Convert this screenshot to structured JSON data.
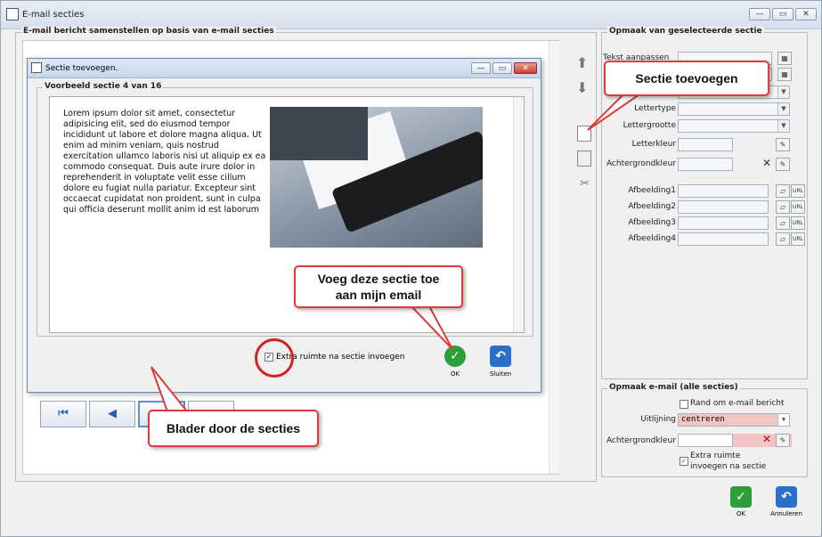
{
  "window": {
    "title": "E-mail secties"
  },
  "compose_group": {
    "title": "E-mail bericht samenstellen op basis van e-mail secties"
  },
  "format_selected": {
    "title": "Opmaak van geselecteerde sectie",
    "tekst_label": "Tekst aanpassen",
    "lettertype_label": "Lettertype",
    "lettergrootte_label": "Lettergrootte",
    "letterkleur_label": "Letterkleur",
    "achtergrondkleur_label": "Achtergrondkleur",
    "afbeelding_labels": [
      "Afbeelding1",
      "Afbeelding2",
      "Afbeelding3",
      "Afbeelding4"
    ]
  },
  "format_email": {
    "title": "Opmaak e-mail (alle secties)",
    "rand_label": "Rand om e-mail bericht",
    "uitlijning_label": "Uitlijning",
    "uitlijning_value": "centreren",
    "achtergrondkleur_label": "Achtergrondkleur",
    "extra_label_1": "Extra ruimte",
    "extra_label_2": "invoegen na sectie"
  },
  "dialog": {
    "title": "Sectie toevoegen.",
    "preview_title": "Voorbeeld sectie 4 van 16",
    "preview_text": "Lorem ipsum dolor sit amet, consectetur adipisicing elit, sed do eiusmod tempor incididunt ut labore et dolore magna aliqua. Ut enim ad minim veniam, quis nostrud exercitation ullamco laboris nisi ut aliquip ex ea commodo consequat. Duis aute irure dolor in reprehenderit in voluptate velit esse cillum dolore eu fugiat nulla pariatur. Excepteur sint occaecat cupidatat non proident, sunt in culpa qui officia deserunt mollit anim id est laborum",
    "extra_checkbox_label": "Extra ruimte na sectie invoegen",
    "ok_label": "OK",
    "close_label": "Sluiten"
  },
  "footer": {
    "ok_label": "OK",
    "cancel_label": "Annuleren"
  },
  "callouts": {
    "add_section": "Sectie toevoegen",
    "add_to_email_1": "Voeg deze sectie toe",
    "add_to_email_2": "aan mijn email",
    "browse": "Blader door de secties"
  },
  "colors": {
    "callout_border": "#e03a3a",
    "ok_green": "#2e9e3a",
    "blue_button": "#2a6fc9",
    "uitlijning_bg": "#f2c4c4"
  }
}
